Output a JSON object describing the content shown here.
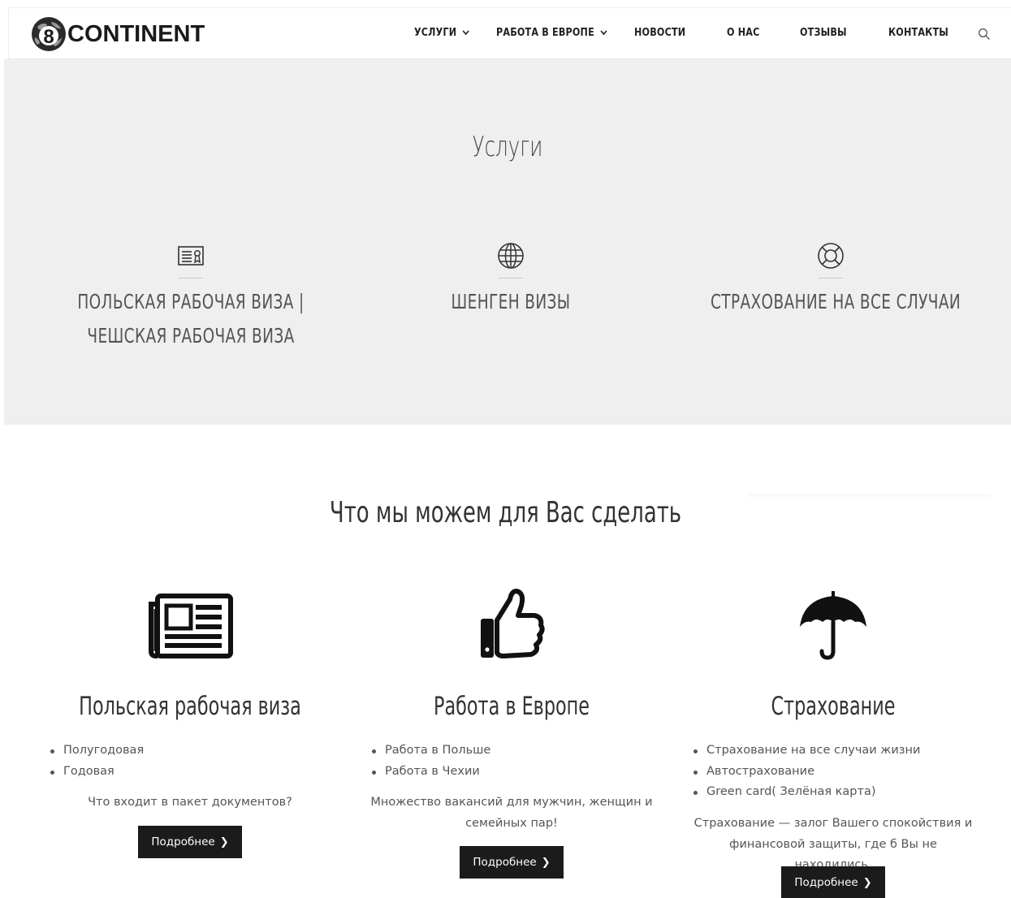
{
  "header": {
    "logo_text": "CONTINENT",
    "logo_digit": "8",
    "nav": [
      {
        "label": "УСЛУГИ",
        "dropdown": true
      },
      {
        "label": "РАБОТА В ЕВРОПЕ",
        "dropdown": true
      },
      {
        "label": "НОВОСТИ",
        "dropdown": false
      },
      {
        "label": "О НАС",
        "dropdown": false
      },
      {
        "label": "ОТЗЫВЫ",
        "dropdown": false
      },
      {
        "label": "КОНТАКТЫ",
        "dropdown": false
      }
    ],
    "chevron": "⌄"
  },
  "services": {
    "title": "Услуги",
    "items": [
      {
        "icon": "id-card-icon",
        "line1": "ПОЛЬСКАЯ РАБОЧАЯ ВИЗА |",
        "line2": "ЧЕШСКАЯ РАБОЧАЯ ВИЗА"
      },
      {
        "icon": "globe-icon",
        "line1": "ШЕНГЕН ВИЗЫ",
        "line2": ""
      },
      {
        "icon": "lifebuoy-icon",
        "line1": "СТРАХОВАНИЕ НА ВСЕ СЛУЧАИ",
        "line2": ""
      }
    ]
  },
  "what_we_do": {
    "title": "Что мы можем для Вас сделать",
    "cards": [
      {
        "icon": "newspaper-icon",
        "title": "Польская рабочая виза",
        "list": [
          "Полугодовая",
          "Годовая"
        ],
        "desc": "Что входит в пакет документов?",
        "button": "Подробнее"
      },
      {
        "icon": "thumbs-up-icon",
        "title": "Работа в Европе",
        "list": [
          "Работа в Польше",
          "Работа в Чехии"
        ],
        "desc": "Множество вакансий для мужчин, женщин и семейных пар!",
        "button": "Подробнее"
      },
      {
        "icon": "umbrella-icon",
        "title": "Страхование",
        "list": [
          "Страхование на все случаи жизни",
          "Автострахование",
          "Green card( Зелёная карта)"
        ],
        "desc": "Страхование — залог Вашего спокойствия и финансовой защиты, где б Вы не находились.",
        "button": "Подробнее"
      }
    ],
    "button_chevron": "❯"
  },
  "colors": {
    "band_bg": "#efefef",
    "button_bg": "#1b1b1b",
    "text": "#333333"
  }
}
